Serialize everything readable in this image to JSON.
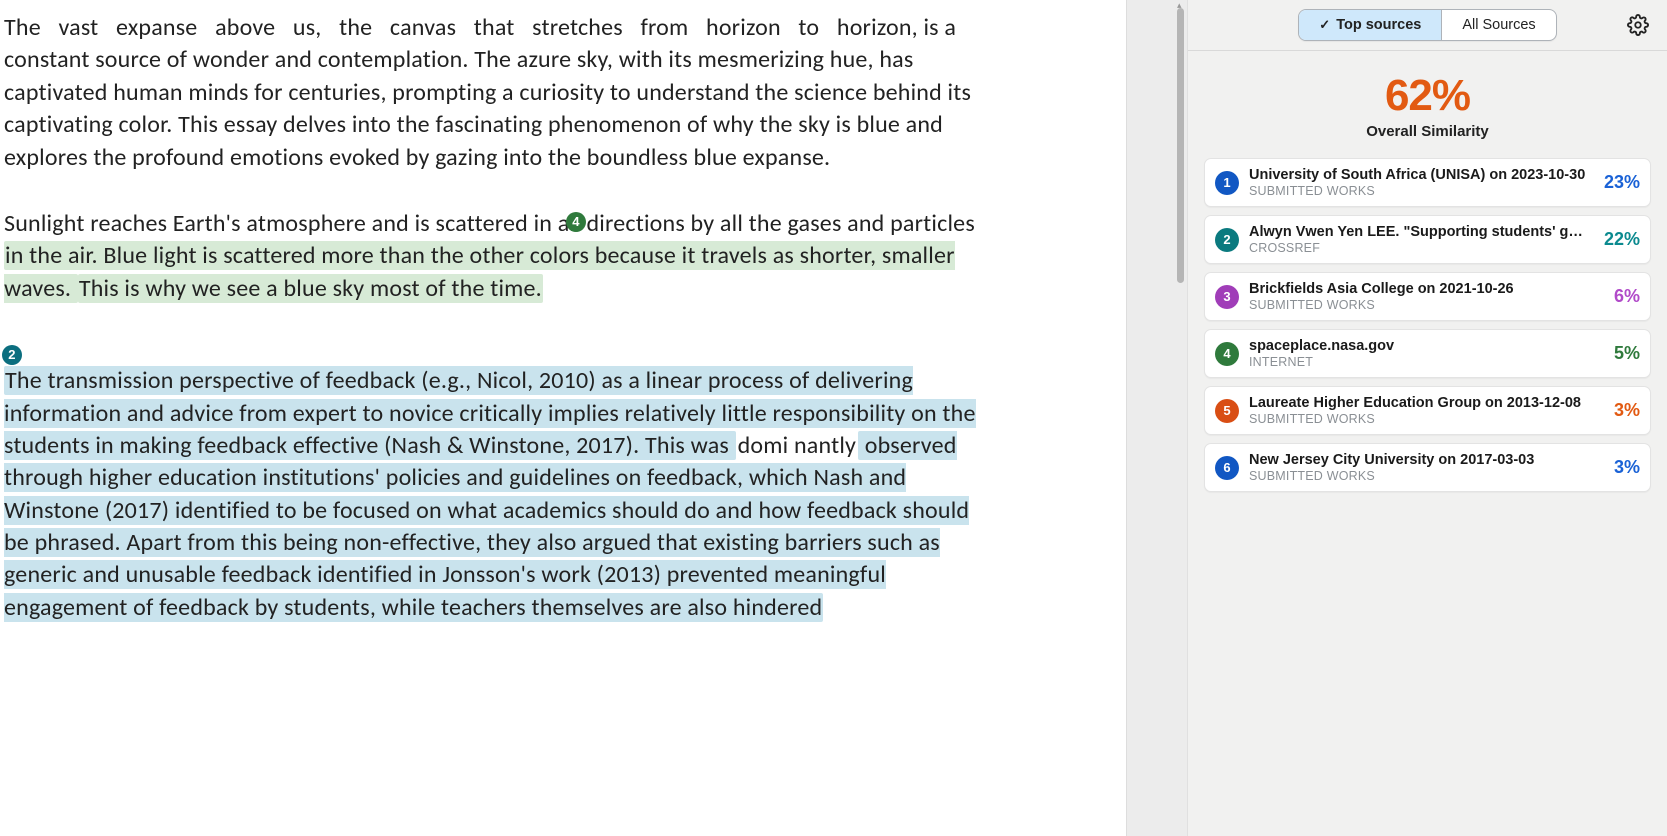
{
  "document": {
    "para1_a": "The   vast   expanse   above   us,   the   canvas   that stretches from horizon to horizon,",
    "para1_b": " is a constant source of wonder and contemplation. The azure sky, with its mesmerizing hue, has captivated human minds for centuries, prompting a curiosity to understand the science behind its captivating color. This essay delves into the fascinating phenomenon of why the sky is blue and explores the profound emotions evoked by gazing into the boundless blue expanse.",
    "para2_a": "Sunlight  reaches  Earth's  atmosphere  and  is  scattered  in all directions  by  all  the  gases  and  particles  ",
    "para2_hl": "in the air. Blue light is scattered more than the other colors because it travels as shorter, smaller waves. ",
    "para2_c": "This is why we see a blue sky most of the time.",
    "badge4": "4",
    "para3_a": "The transmission perspective of feedback (e.g., Nicol, 2010) as a linear process of delivering information and advice from expert to novice critically implies relatively little responsibility on the students in making feedback effective (Nash & Winstone, 2017). This was ",
    "para3_gap": "domi nantly",
    "para3_b": " observed through higher education institutions' policies and guidelines on feedback, which Nash and Winstone (2017) identified to be focused on what academics should do and how feedback should be phrased. Apart from this being non-effective, they also argued that existing barriers such as generic and unusable feedback identified in Jonsson's work (2013) prevented meaningful engagement of feedback by students, while teachers themselves are also hindered",
    "badge2": "2"
  },
  "sidebar": {
    "tab_top": "Top sources",
    "tab_all": "All Sources",
    "overall_pct": "62%",
    "overall_label": "Overall Similarity",
    "sources": [
      {
        "n": "1",
        "title": "University of South Africa (UNISA) on 2023-10-30",
        "type": "SUBMITTED WORKS",
        "pct": "23%"
      },
      {
        "n": "2",
        "title": "Alwyn Vwen Yen LEE. \"Supporting students' ge...",
        "type": "CROSSREF",
        "pct": "22%"
      },
      {
        "n": "3",
        "title": "Brickfields Asia College on 2021-10-26",
        "type": "SUBMITTED WORKS",
        "pct": "6%"
      },
      {
        "n": "4",
        "title": "spaceplace.nasa.gov",
        "type": "INTERNET",
        "pct": "5%"
      },
      {
        "n": "5",
        "title": "Laureate Higher Education Group on 2013-12-08",
        "type": "SUBMITTED WORKS",
        "pct": "3%"
      },
      {
        "n": "6",
        "title": "New Jersey City University on 2017-03-03",
        "type": "SUBMITTED WORKS",
        "pct": "3%"
      }
    ]
  }
}
